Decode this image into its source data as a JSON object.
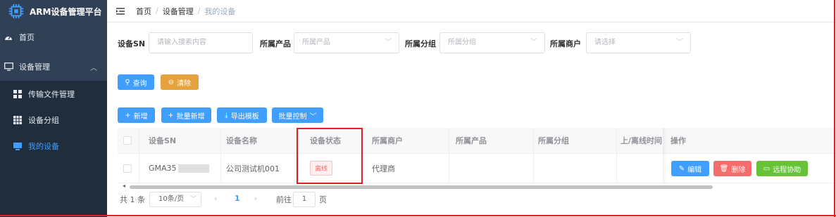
{
  "app": {
    "title": "ARM设备管理平台"
  },
  "sidebar": {
    "items": [
      {
        "label": "首页",
        "icon": "dashboard-icon"
      },
      {
        "label": "设备管理",
        "icon": "monitor-icon",
        "expanded": true
      },
      {
        "label": "传输文件管理",
        "icon": "grid-icon"
      },
      {
        "label": "设备分组",
        "icon": "table-icon"
      },
      {
        "label": "我的设备",
        "icon": "device-icon",
        "active": true
      }
    ]
  },
  "breadcrumb": [
    "首页",
    "设备管理",
    "我的设备"
  ],
  "search": {
    "sn_label": "设备SN",
    "sn_placeholder": "请输入搜索内容",
    "product_label": "所属产品",
    "product_placeholder": "所属产品",
    "group_label": "所属分组",
    "group_placeholder": "所属分组",
    "merchant_label": "所属商户",
    "merchant_placeholder": "请选择",
    "query_label": "查询",
    "clear_label": "清除"
  },
  "toolbar": {
    "add_label": "新增",
    "batch_add_label": "批量新增",
    "export_template_label": "导出模板",
    "batch_control_label": "批量控制"
  },
  "table": {
    "columns": [
      "设备SN",
      "设备名称",
      "设备状态",
      "所属商户",
      "所属产品",
      "所属分组",
      "上/离线时间",
      "操作"
    ],
    "rows": [
      {
        "sn": "GMA35",
        "name": "公司测试机001",
        "status": "离线",
        "merchant": "代理商",
        "product": "",
        "group": "",
        "time": ""
      }
    ],
    "actions": {
      "edit": "编辑",
      "delete": "删除",
      "remote": "远程协助"
    }
  },
  "pagination": {
    "total": "共 1 条",
    "page_size": "10条/页",
    "current": "1",
    "goto_prefix": "前往",
    "goto_value": "1",
    "goto_suffix": "页"
  },
  "colors": {
    "sidebar": "#304156",
    "primary": "#409eff",
    "warning": "#e6a23c",
    "danger": "#f56c6c",
    "success": "#67c23a",
    "highlight": "#e02020"
  }
}
